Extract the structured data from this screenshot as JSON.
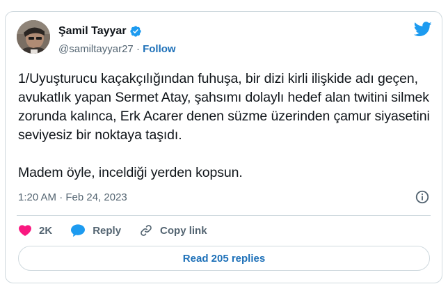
{
  "author": {
    "display_name": "Şamil Tayyar",
    "handle": "@samiltayyar27",
    "separator": "·",
    "follow_label": "Follow"
  },
  "tweet": {
    "text": "1/Uyuşturucu kaçakçılığından fuhuşa, bir dizi kirli ilişkide adı geçen, avukatlık yapan Sermet Atay, şahsımı dolaylı hedef alan twitini silmek zorunda kalınca, Erk Acarer denen süzme üzerinden çamur siyasetini seviyesiz bir noktaya taşıdı.\n\nMadem öyle, inceldiği yerden kopsun.",
    "timestamp": "1:20 AM · Feb 24, 2023"
  },
  "actions": {
    "like_count": "2K",
    "reply_label": "Reply",
    "copy_link_label": "Copy link"
  },
  "replies_button": {
    "label": "Read 205 replies"
  },
  "colors": {
    "twitter_blue": "#1d9bf0",
    "link_blue": "#1d70b8",
    "like_pink": "#f91880",
    "text": "#0f1419",
    "muted": "#536471",
    "border": "#cfd9de"
  },
  "icons": [
    "avatar",
    "verified-badge-icon",
    "twitter-bird-icon",
    "info-icon",
    "heart-icon",
    "reply-bubble-icon",
    "link-icon"
  ]
}
